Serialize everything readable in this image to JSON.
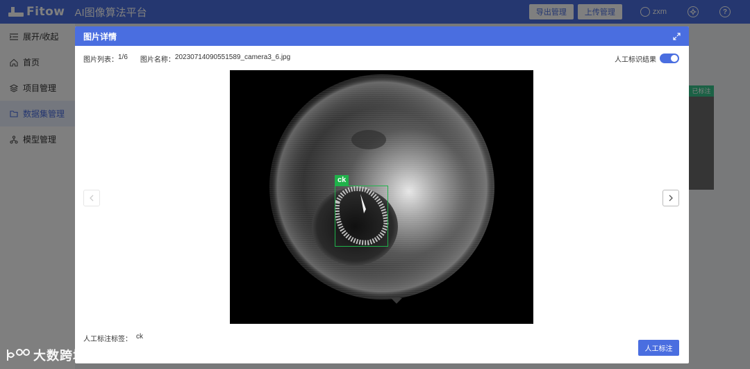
{
  "app": {
    "logo_text": "Fitow",
    "platform_name": "AI图像算法平台",
    "top_buttons": [
      "导出管理",
      "上传管理"
    ],
    "user_name": "zxm"
  },
  "sidebar": {
    "items": [
      {
        "label": "展开/收起",
        "icon": "collapse-icon"
      },
      {
        "label": "首页",
        "icon": "home-icon"
      },
      {
        "label": "项目管理",
        "icon": "layers-icon"
      },
      {
        "label": "数据集管理",
        "icon": "folder-icon",
        "active": true
      },
      {
        "label": "模型管理",
        "icon": "model-icon"
      }
    ]
  },
  "background": {
    "card_tag": "已标注"
  },
  "modal": {
    "title": "图片详情",
    "list_label": "图片列表：",
    "list_value": "1/6",
    "name_label": "图片名称：",
    "name_value": "20230714090551589_camera3_6.jpg",
    "toggle_label": "人工标识结果",
    "toggle_on": true,
    "annotation_box_label": "ck",
    "annotation_color": "#1fb24a",
    "tag_label": "人工标注标签：",
    "tag_value": "ck",
    "annotate_button": "人工标注",
    "prev_icon": "chevron-left-icon",
    "next_icon": "chevron-right-icon"
  },
  "watermark": {
    "text": "大数跨境"
  },
  "colors": {
    "primary": "#4a6ee0",
    "success": "#36c28a"
  }
}
